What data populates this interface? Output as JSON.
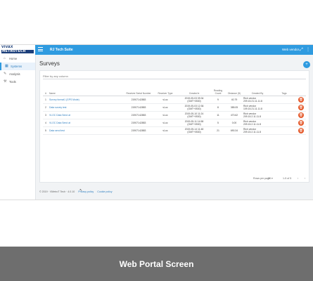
{
  "header": {
    "logo_top": "VIVAX",
    "logo_bottom": "METROTECH",
    "title": "RJ Tech Suite",
    "user": "Web vendor"
  },
  "sidebar": {
    "items": [
      {
        "label": "Home",
        "icon": "home-icon",
        "active": false
      },
      {
        "label": "Systems",
        "icon": "systems-icon",
        "active": true
      },
      {
        "label": "Analysis",
        "icon": "analysis-icon",
        "active": false
      },
      {
        "label": "Tools",
        "icon": "tools-icon",
        "active": false
      }
    ]
  },
  "main": {
    "page_title": "Surveys",
    "filter_placeholder": "Filter by any column",
    "columns": [
      "#",
      "Name",
      "Receiver Serial Number",
      "Receiver Type",
      "Created",
      "Reading Count",
      "Distance (ft)",
      "Created By",
      "Tags",
      ""
    ],
    "rows": [
      {
        "num": "1",
        "name": "Survey format1 (GPS Mode)",
        "serial": "21907142883",
        "type": "vLoc",
        "created": "2019-05-03 09:34 (GMT+0530)",
        "count": "9",
        "distance": "40.79",
        "by": "Rich vendor 209.15.21.11.11.8"
      },
      {
        "num": "2",
        "name": "Data survey test",
        "serial": "21907142883",
        "type": "vLoc",
        "created": "2019-05-03 12:36 (GMT+0530)",
        "count": "8",
        "distance": "385.05",
        "by": "Rich vendor 109.15.21.11.11.8"
      },
      {
        "num": "3",
        "name": "VLOC Data Send at",
        "serial": "21907142883",
        "type": "vLoc",
        "created": "2019-05-10 11:24 (GMT+0530)",
        "count": "11",
        "distance": "470.62",
        "by": "Rich vendor 209.15.2.11.11.8"
      },
      {
        "num": "4",
        "name": "VLOC Data Send at",
        "serial": "21907142883",
        "type": "vLoc",
        "created": "2019-05-11 14:58 (GMT+0530)",
        "count": "5",
        "distance": "0.00",
        "by": "Rich vendor 209.15.2.11.11.8"
      },
      {
        "num": "5",
        "name": "Data send test",
        "serial": "21907142883",
        "type": "vLoc",
        "created": "2019-05-14 11:48 (GMT+0530)",
        "count": "21",
        "distance": "690.34",
        "by": "Rich vendor 209.15.2.11.11.8"
      }
    ],
    "pager": {
      "rows_label": "Rows per page",
      "rows_value": "20",
      "range": "1-5 of 5"
    }
  },
  "footer": {
    "copyright": "© 2019 · VMetroT Tech · 4.0.10",
    "privacy": "Privacy policy",
    "cookie": "Cookie policy"
  },
  "banner": {
    "text": "Web Portal Screen"
  },
  "colors": {
    "accent": "#2f9be0",
    "delete": "#e45a2c",
    "banner": "#6e6e6e"
  }
}
